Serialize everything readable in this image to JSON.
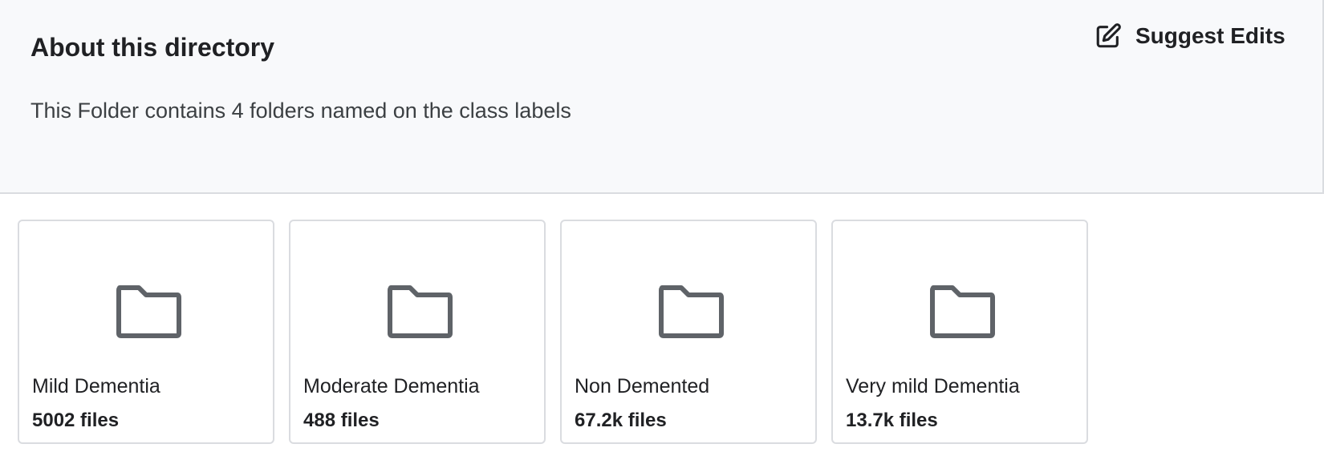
{
  "about": {
    "title": "About this directory",
    "description": "This Folder contains 4 folders named on the class labels",
    "suggest_edits_label": "Suggest Edits",
    "suggest_edits_icon": "edit-icon"
  },
  "folders": [
    {
      "name": "Mild Dementia",
      "count": "5002 files",
      "icon": "folder-icon"
    },
    {
      "name": "Moderate Dementia",
      "count": "488 files",
      "icon": "folder-icon"
    },
    {
      "name": "Non Demented",
      "count": "67.2k files",
      "icon": "folder-icon"
    },
    {
      "name": "Very mild Dementia",
      "count": "13.7k files",
      "icon": "folder-icon"
    }
  ],
  "colors": {
    "panel_background": "#f8f9fb",
    "border": "#dadce0",
    "icon": "#5f6368",
    "text": "#202124"
  }
}
